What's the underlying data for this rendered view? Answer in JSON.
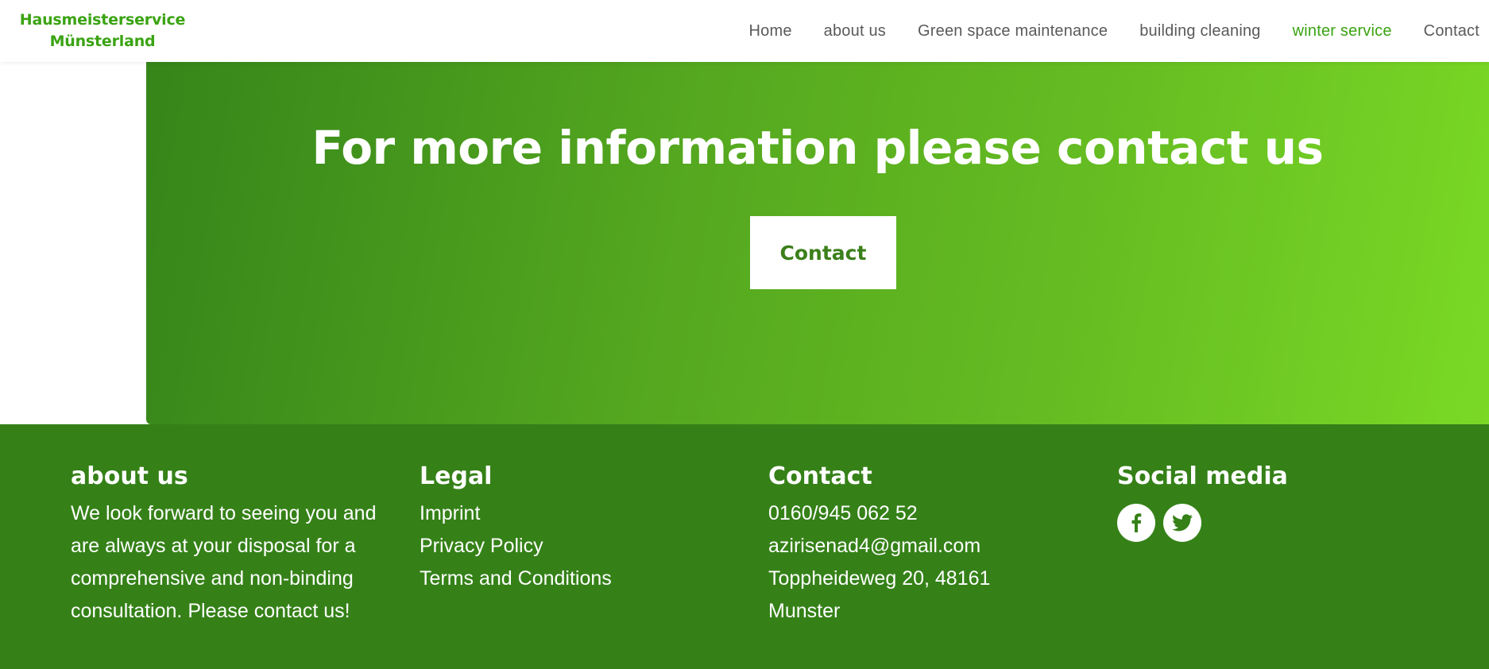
{
  "header": {
    "logo_line1": "Hausmeisterservice",
    "logo_line2": "Münsterland",
    "nav": [
      {
        "label": "Home"
      },
      {
        "label": "about us"
      },
      {
        "label": "Green space maintenance"
      },
      {
        "label": "building cleaning"
      },
      {
        "label": "winter service"
      },
      {
        "label": "Contact"
      }
    ],
    "active_nav": "winter service"
  },
  "hero": {
    "title": "For more information please contact us",
    "button_label": "Contact"
  },
  "footer": {
    "about": {
      "heading": "about us",
      "text": "We look forward to seeing you and are always at your disposal for a comprehensive and non-binding consultation. Please contact us!"
    },
    "legal": {
      "heading": "Legal",
      "links": [
        "Imprint",
        "Privacy Policy",
        "Terms and Conditions"
      ]
    },
    "contact": {
      "heading": "Contact",
      "phone": "0160/945 062 52",
      "email": "azirisenad4@gmail.com",
      "address_line1": "Toppheideweg 20, 48161",
      "address_line2": "Munster"
    },
    "social": {
      "heading": "Social media",
      "icons": [
        "facebook-icon",
        "twitter-icon"
      ]
    }
  },
  "colors": {
    "brand_green": "#3aa312",
    "footer_bg": "#358118",
    "hero_start": "#35851a",
    "hero_end": "#7ad925",
    "nav_text": "#5a5a5a",
    "button_text": "#3b7f1a"
  }
}
